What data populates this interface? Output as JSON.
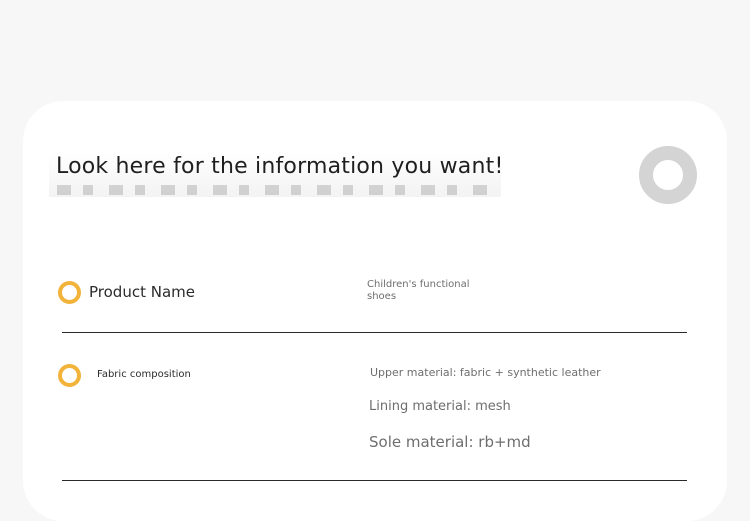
{
  "header": {
    "headline": "Look here for the information you want!"
  },
  "rows": [
    {
      "label": "Product Name",
      "value": "Children's functional shoes"
    },
    {
      "label": "Fabric composition",
      "values": [
        "Upper material: fabric + synthetic leather",
        "Lining material: mesh",
        "Sole material: rb+md"
      ]
    }
  ],
  "colors": {
    "accent": "#f2b33b",
    "ring": "#d4d4d4",
    "background": "#f7f7f7",
    "card": "#ffffff",
    "divider": "#2a2a2a"
  },
  "icons": {
    "decorative_ring": "circle-ring-icon",
    "bullet": "circle-bullet-icon"
  }
}
